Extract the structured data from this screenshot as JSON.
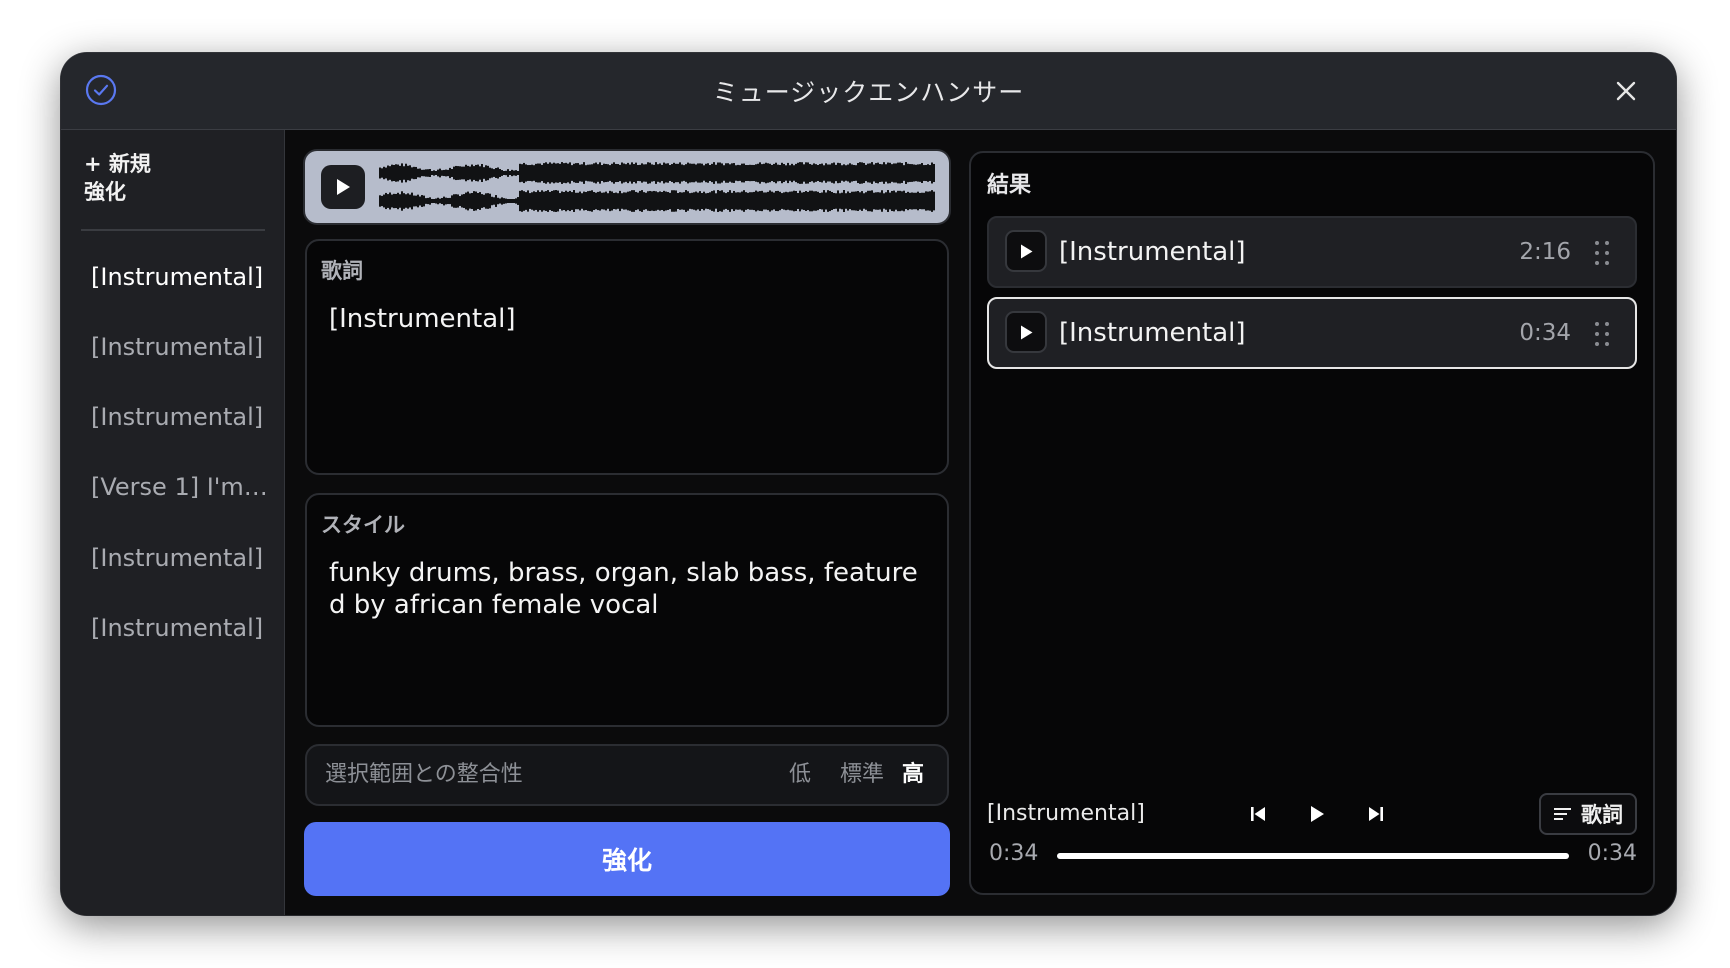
{
  "window": {
    "title": "ミュージックエンハンサー"
  },
  "sidebar": {
    "new_label": "+ 新規\n強化",
    "items": [
      {
        "label": "[Instrumental]",
        "active": true
      },
      {
        "label": "[Instrumental]",
        "active": false
      },
      {
        "label": "[Instrumental]",
        "active": false
      },
      {
        "label": "[Verse 1] I'm…",
        "active": false
      },
      {
        "label": "[Instrumental]",
        "active": false
      },
      {
        "label": "[Instrumental]",
        "active": false
      }
    ]
  },
  "lyrics_panel": {
    "label": "歌詞",
    "value": "[Instrumental]"
  },
  "style_panel": {
    "label": "スタイル",
    "value": "funky drums, brass, organ, slab bass, featured by african female vocal"
  },
  "alignment": {
    "label": "選択範囲との整合性",
    "options": [
      "低",
      "標準",
      "高"
    ],
    "selected": "高"
  },
  "enhance_button": "強化",
  "results": {
    "title": "結果",
    "items": [
      {
        "title": "[Instrumental]",
        "duration": "2:16",
        "selected": false
      },
      {
        "title": "[Instrumental]",
        "duration": "0:34",
        "selected": true
      }
    ]
  },
  "player": {
    "track_title": "[Instrumental]",
    "lyrics_label": "歌詞",
    "elapsed": "0:34",
    "total": "0:34",
    "progress": 1.0
  },
  "colors": {
    "accent": "#5473f5",
    "window_bg": "#0b0b0c",
    "panel_bg": "#060607",
    "sidebar_bg": "#1f2024",
    "waveform_bg": "#b6bccb"
  }
}
